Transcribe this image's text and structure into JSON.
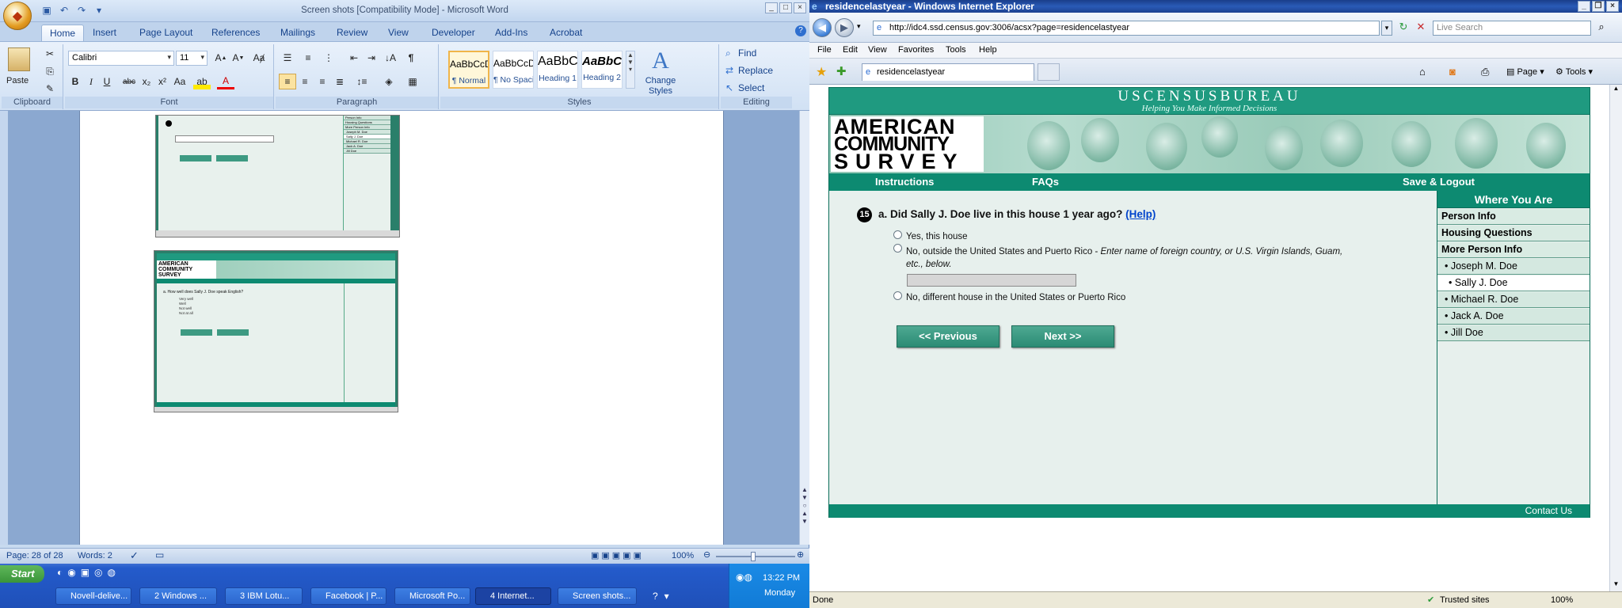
{
  "word": {
    "title": "Screen shots [Compatibility Mode] - Microsoft Word",
    "tabs": [
      "Home",
      "Insert",
      "Page Layout",
      "References",
      "Mailings",
      "Review",
      "View",
      "Developer",
      "Add-Ins",
      "Acrobat"
    ],
    "font_name": "Calibri",
    "font_size": "11",
    "groups": {
      "clipboard": "Clipboard",
      "font": "Font",
      "paragraph": "Paragraph",
      "styles": "Styles",
      "editing": "Editing"
    },
    "paste_label": "Paste",
    "styles": [
      {
        "preview": "AaBbCcDc",
        "name": "¶ Normal"
      },
      {
        "preview": "AaBbCcDc",
        "name": "¶ No Spaci..."
      },
      {
        "preview": "AaBbC",
        "name": "Heading 1"
      },
      {
        "preview": "AaBbCc",
        "name": "Heading 2"
      }
    ],
    "change_styles": "Change Styles",
    "editing": {
      "find": "Find",
      "replace": "Replace",
      "select": "Select"
    },
    "status": {
      "page": "Page: 28 of 28",
      "words": "Words: 2",
      "zoom": "100%"
    }
  },
  "taskbar": {
    "start": "Start",
    "tasks": [
      "Novell-delive...",
      "2 Windows ...",
      "3 IBM Lotu...",
      "Facebook | P...",
      "Microsoft Po...",
      "4 Internet...",
      "Screen shots..."
    ],
    "time": "13:22 PM",
    "day": "Monday"
  },
  "ie": {
    "title": "residencelastyear - Windows Internet Explorer",
    "address": "http://idc4.ssd.census.gov:3006/acsx?page=residencelastyear",
    "search_placeholder": "Live Search",
    "menu": [
      "File",
      "Edit",
      "View",
      "Favorites",
      "Tools",
      "Help"
    ],
    "tab_title": "residencelastyear",
    "tools": {
      "page": "Page",
      "tools": "Tools"
    },
    "status_left": "Done",
    "status_zone": "Trusted sites",
    "zoom": "100%"
  },
  "acs": {
    "bureau": "USCENSUSBUREAU",
    "tagline": "Helping You Make Informed Decisions",
    "logo_lines": [
      "AMERICAN",
      "COMMUNITY",
      "SURVEY"
    ],
    "nav": {
      "instructions": "Instructions",
      "faqs": "FAQs",
      "save": "Save & Logout"
    },
    "question_number": "15",
    "question": "a. Did Sally J. Doe live in this house 1 year ago?",
    "help": "(Help)",
    "options": [
      "Yes, this house",
      "No, outside the United States and Puerto Rico - ",
      "No, different house in the United States or Puerto Rico"
    ],
    "option2_italic": "Enter name of foreign country, or U.S. Virgin Islands, Guam, etc., below.",
    "buttons": {
      "previous": "<<   Previous",
      "next": "Next   >>"
    },
    "sidebar": {
      "header": "Where You Are",
      "items": [
        "Person Info",
        "Housing Questions",
        "More Person Info",
        "• Joseph M. Doe",
        "• Sally J. Doe",
        "• Michael R. Doe",
        "• Jack A. Doe",
        "• Jill Doe"
      ]
    },
    "contact": "Contact Us"
  },
  "thumbs": [
    {
      "nav": [
        "Person Info",
        "Housing Questions",
        "More Person Info"
      ],
      "people": [
        "Joseph M. Doe",
        "Sally J. Doe",
        "Michael R. Doe",
        "Jack A. Doe",
        "Jill Doe"
      ]
    },
    {
      "question": "a. How well does Sally J. Doe speak English?",
      "options": [
        "Very well",
        "Well",
        "Not well",
        "Not at all"
      ]
    }
  ]
}
